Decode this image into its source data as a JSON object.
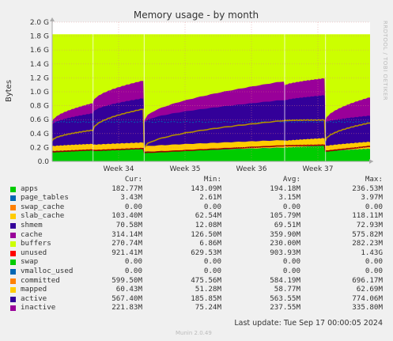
{
  "chart_data": {
    "type": "area",
    "title": "Memory usage - by month",
    "ylabel": "Bytes",
    "side_label": "RRDTOOL / TOBI OETIKER",
    "ylim_gib": [
      0,
      2.0
    ],
    "yticks": [
      "0.0",
      "0.2 G",
      "0.4 G",
      "0.6 G",
      "0.8 G",
      "1.0 G",
      "1.2 G",
      "1.4 G",
      "1.6 G",
      "1.8 G",
      "2.0 G"
    ],
    "yticks_gib": [
      0,
      0.2,
      0.4,
      0.6,
      0.8,
      1.0,
      1.2,
      1.4,
      1.6,
      1.8,
      2.0
    ],
    "grid": true,
    "x_labels": [
      "Week 34",
      "Week 35",
      "Week 36",
      "Week 37"
    ],
    "x_label_days": [
      7,
      14,
      21,
      28
    ],
    "x_range_days": [
      0,
      33.5
    ],
    "reboot_days": [
      4.3,
      9.7,
      24.5,
      28.8
    ],
    "total_mib": 1870,
    "data_end_day": 33.5,
    "stack": [
      {
        "name": "apps",
        "color": "#00cc00"
      },
      {
        "name": "page_tables",
        "color": "#0066b3"
      },
      {
        "name": "swap_cache",
        "color": "#ff8000"
      },
      {
        "name": "slab_cache",
        "color": "#ffcc00"
      },
      {
        "name": "shmem",
        "color": "#330099"
      },
      {
        "name": "cache",
        "color": "#990099"
      },
      {
        "name": "buffers",
        "color": "#ccff00"
      },
      {
        "name": "unused",
        "color": "#ff0000"
      }
    ],
    "lines": [
      {
        "name": "committed",
        "color": "#00487d"
      },
      {
        "name": "active",
        "color": "#b38f00"
      },
      {
        "name": "inactive",
        "color": "#990000"
      }
    ],
    "segments": [
      {
        "start": 0,
        "end": 4.3,
        "apps": [
          150,
          170
        ],
        "slab": [
          70,
          85
        ],
        "cache": [
          240,
          380
        ],
        "buffers": [
          40,
          150
        ],
        "active": [
          300,
          460
        ],
        "inactive": [
          140,
          170
        ]
      },
      {
        "start": 4.3,
        "end": 9.6,
        "apps": [
          160,
          180
        ],
        "slab": [
          80,
          95
        ],
        "cache": [
          400,
          580
        ],
        "buffers": [
          150,
          260
        ],
        "active": [
          460,
          770
        ],
        "inactive": [
          160,
          190
        ]
      },
      {
        "start": 9.7,
        "end": 24.4,
        "apps": [
          140,
          200
        ],
        "slab": [
          75,
          110
        ],
        "cache": [
          280,
          520
        ],
        "buffers": [
          30,
          275
        ],
        "active": [
          200,
          600
        ],
        "inactive": [
          130,
          230
        ]
      },
      {
        "start": 24.5,
        "end": 28.7,
        "apps": [
          200,
          230
        ],
        "slab": [
          100,
          110
        ],
        "cache": [
          520,
          560
        ],
        "buffers": [
          220,
          250
        ],
        "active": [
          600,
          610
        ],
        "inactive": [
          230,
          240
        ]
      },
      {
        "start": 28.8,
        "end": 33.5,
        "apps": [
          150,
          183
        ],
        "slab": [
          70,
          103
        ],
        "cache": [
          280,
          314
        ],
        "buffers": [
          20,
          271
        ],
        "active": [
          300,
          567
        ],
        "inactive": [
          150,
          222
        ]
      }
    ]
  },
  "legend": {
    "headers": {
      "cur": "Cur:",
      "min": "Min:",
      "avg": "Avg:",
      "max": "Max:"
    },
    "rows": [
      {
        "name": "apps",
        "color": "#00cc00",
        "cur": "182.77M",
        "min": "143.09M",
        "avg": "194.18M",
        "max": "236.53M"
      },
      {
        "name": "page_tables",
        "color": "#0066b3",
        "cur": "3.43M",
        "min": "2.61M",
        "avg": "3.15M",
        "max": "3.97M"
      },
      {
        "name": "swap_cache",
        "color": "#ff8000",
        "cur": "0.00",
        "min": "0.00",
        "avg": "0.00",
        "max": "0.00"
      },
      {
        "name": "slab_cache",
        "color": "#ffcc00",
        "cur": "103.40M",
        "min": "62.54M",
        "avg": "105.79M",
        "max": "118.11M"
      },
      {
        "name": "shmem",
        "color": "#330099",
        "cur": "70.58M",
        "min": "12.08M",
        "avg": "69.51M",
        "max": "72.93M"
      },
      {
        "name": "cache",
        "color": "#990099",
        "cur": "314.14M",
        "min": "126.50M",
        "avg": "359.90M",
        "max": "575.82M"
      },
      {
        "name": "buffers",
        "color": "#ccff00",
        "cur": "270.74M",
        "min": "6.86M",
        "avg": "230.00M",
        "max": "282.23M"
      },
      {
        "name": "unused",
        "color": "#ff0000",
        "cur": "921.41M",
        "min": "629.53M",
        "avg": "903.93M",
        "max": "1.43G"
      },
      {
        "name": "swap",
        "color": "#00cc00",
        "cur": "0.00",
        "min": "0.00",
        "avg": "0.00",
        "max": "0.00"
      },
      {
        "name": "vmalloc_used",
        "color": "#0066b3",
        "cur": "0.00",
        "min": "0.00",
        "avg": "0.00",
        "max": "0.00"
      },
      {
        "name": "committed",
        "color": "#ff8000",
        "cur": "599.50M",
        "min": "475.56M",
        "avg": "584.19M",
        "max": "696.17M"
      },
      {
        "name": "mapped",
        "color": "#ffcc00",
        "cur": "60.43M",
        "min": "51.28M",
        "avg": "58.77M",
        "max": "62.69M"
      },
      {
        "name": "active",
        "color": "#330099",
        "cur": "567.40M",
        "min": "185.85M",
        "avg": "563.55M",
        "max": "774.06M"
      },
      {
        "name": "inactive",
        "color": "#990099",
        "cur": "221.83M",
        "min": "75.24M",
        "avg": "237.55M",
        "max": "335.80M"
      }
    ]
  },
  "footer": {
    "last_update": "Last update: Tue Sep 17 00:00:05 2024",
    "munin": "Munin 2.0.49"
  }
}
